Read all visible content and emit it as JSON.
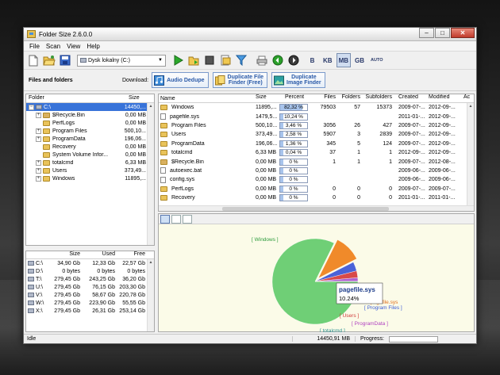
{
  "window": {
    "title": "Folder Size 2.6.0.0"
  },
  "window_controls": {
    "minimize": "–",
    "maximize": "□",
    "close": "✕"
  },
  "menu": [
    "File",
    "Scan",
    "View",
    "Help"
  ],
  "toolbar": {
    "drive_combo": "Dysk lokalny (C:)",
    "units": [
      "B",
      "KB",
      "MB",
      "GB",
      "AUTO"
    ],
    "active_unit": "MB"
  },
  "toolbar2": {
    "files_and_folders": "Files and folders",
    "download_label": "Download:",
    "promo_audio": "Audio Dedupe",
    "promo_dup_line1": "Duplicate File",
    "promo_dup_line2": "Finder (Free)",
    "promo_img_line1": "Duplicate",
    "promo_img_line2": "Image Finder"
  },
  "tree": {
    "col_folder": "Folder",
    "col_size": "Size",
    "rows": [
      {
        "name": "C:\\",
        "size": "14450,...",
        "level": 0,
        "type": "drive",
        "selected": true
      },
      {
        "name": "$Recycle.Bin",
        "size": "0,00 MB",
        "level": 1,
        "type": "lockfolder"
      },
      {
        "name": "PerfLogs",
        "size": "0,00 MB",
        "level": 1,
        "type": "folder"
      },
      {
        "name": "Program Files",
        "size": "500,10...",
        "level": 1,
        "type": "folder"
      },
      {
        "name": "ProgramData",
        "size": "196,06...",
        "level": 1,
        "type": "folder"
      },
      {
        "name": "Recovery",
        "size": "0,00 MB",
        "level": 1,
        "type": "folder"
      },
      {
        "name": "System Volume Infor...",
        "size": "0,00 MB",
        "level": 1,
        "type": "folder"
      },
      {
        "name": "totalcmd",
        "size": "6,33 MB",
        "level": 1,
        "type": "folder"
      },
      {
        "name": "Users",
        "size": "373,49...",
        "level": 1,
        "type": "folder"
      },
      {
        "name": "Windows",
        "size": "11895,...",
        "level": 1,
        "type": "folder"
      }
    ]
  },
  "drives": {
    "headers": [
      "",
      "Size",
      "Used",
      "Free"
    ],
    "rows": [
      {
        "name": "C:\\",
        "size": "34,90 Gb",
        "used": "12,33 Gb",
        "free": "22,57 Gb"
      },
      {
        "name": "D:\\",
        "size": "0 bytes",
        "used": "0 bytes",
        "free": "0 bytes"
      },
      {
        "name": "T:\\",
        "size": "279,45 Gb",
        "used": "243,25 Gb",
        "free": "36,20 Gb"
      },
      {
        "name": "U:\\",
        "size": "279,45 Gb",
        "used": "76,15 Gb",
        "free": "203,30 Gb"
      },
      {
        "name": "V:\\",
        "size": "279,45 Gb",
        "used": "58,67 Gb",
        "free": "220,78 Gb"
      },
      {
        "name": "W:\\",
        "size": "279,45 Gb",
        "used": "223,90 Gb",
        "free": "55,55 Gb"
      },
      {
        "name": "X:\\",
        "size": "279,45 Gb",
        "used": "26,31 Gb",
        "free": "253,14 Gb"
      }
    ]
  },
  "list": {
    "headers": [
      "Name",
      "Size",
      "Percent",
      "Files",
      "Folders",
      "Subfolders",
      "Created",
      "Modified",
      "Ac"
    ],
    "rows": [
      {
        "name": "Windows",
        "type": "folder",
        "size": "11895,...",
        "pct_text": "82,32 %",
        "pct": 82.32,
        "files": "79503",
        "folders": "57",
        "sub": "15373",
        "created": "2009-07-...",
        "modified": "2012-09-..."
      },
      {
        "name": "pagefile.sys",
        "type": "file",
        "size": "1479,5...",
        "pct_text": "10,24 %",
        "pct": 10.24,
        "files": "",
        "folders": "",
        "sub": "",
        "created": "2011-01-...",
        "modified": "2012-09-..."
      },
      {
        "name": "Program Files",
        "type": "folder",
        "size": "500,10...",
        "pct_text": "3,46 %",
        "pct": 3.46,
        "files": "3056",
        "folders": "26",
        "sub": "427",
        "created": "2009-07-...",
        "modified": "2012-09-..."
      },
      {
        "name": "Users",
        "type": "folder",
        "size": "373,49...",
        "pct_text": "2,58 %",
        "pct": 2.58,
        "files": "5907",
        "folders": "3",
        "sub": "2839",
        "created": "2009-07-...",
        "modified": "2012-09-..."
      },
      {
        "name": "ProgramData",
        "type": "folder",
        "size": "196,06...",
        "pct_text": "1,36 %",
        "pct": 1.36,
        "files": "345",
        "folders": "5",
        "sub": "124",
        "created": "2009-07-...",
        "modified": "2012-09-..."
      },
      {
        "name": "totalcmd",
        "type": "folder",
        "size": "6,33 MB",
        "pct_text": "0,04 %",
        "pct": 0.04,
        "files": "37",
        "folders": "1",
        "sub": "1",
        "created": "2012-09-...",
        "modified": "2012-09-..."
      },
      {
        "name": "$Recycle.Bin",
        "type": "lockfolder",
        "size": "0,00 MB",
        "pct_text": "0 %",
        "pct": 0,
        "files": "1",
        "folders": "1",
        "sub": "1",
        "created": "2009-07-...",
        "modified": "2012-08-..."
      },
      {
        "name": "autoexec.bat",
        "type": "file",
        "size": "0,00 MB",
        "pct_text": "0 %",
        "pct": 0,
        "files": "",
        "folders": "",
        "sub": "",
        "created": "2009-06-...",
        "modified": "2009-06-..."
      },
      {
        "name": "config.sys",
        "type": "file",
        "size": "0,00 MB",
        "pct_text": "0 %",
        "pct": 0,
        "files": "",
        "folders": "",
        "sub": "",
        "created": "2009-06-...",
        "modified": "2009-06-..."
      },
      {
        "name": "PerfLogs",
        "type": "folder",
        "size": "0,00 MB",
        "pct_text": "0 %",
        "pct": 0,
        "files": "0",
        "folders": "0",
        "sub": "0",
        "created": "2009-07-...",
        "modified": "2009-07-..."
      },
      {
        "name": "Recovery",
        "type": "folder",
        "size": "0,00 MB",
        "pct_text": "0 %",
        "pct": 0,
        "files": "0",
        "folders": "0",
        "sub": "0",
        "created": "2011-01-...",
        "modified": "2011-01-..."
      }
    ]
  },
  "chart_data": {
    "type": "pie",
    "title": "",
    "series": [
      {
        "name": "Windows",
        "label": "[ Windows ]",
        "value": 82.32,
        "color": "#6fcf76"
      },
      {
        "name": "pagefile.sys",
        "label": "pagefile.sys",
        "value": 10.24,
        "color": "#f08a2a"
      },
      {
        "name": "Program Files",
        "label": "[ Program Files ]",
        "value": 3.46,
        "color": "#4a62d8"
      },
      {
        "name": "Users",
        "label": "[ Users ]",
        "value": 2.58,
        "color": "#d84a4a"
      },
      {
        "name": "ProgramData",
        "label": "[ ProgramData ]",
        "value": 1.36,
        "color": "#b060d0"
      },
      {
        "name": "totalcmd",
        "label": "[ totalcmd ]",
        "value": 0.04,
        "color": "#3aa0a0"
      }
    ],
    "tooltip": {
      "title": "pagefile.sys",
      "value": "10.24%"
    }
  },
  "status": {
    "text": "Idle",
    "total": "14450,91 MB",
    "progress_label": "Progress:"
  }
}
